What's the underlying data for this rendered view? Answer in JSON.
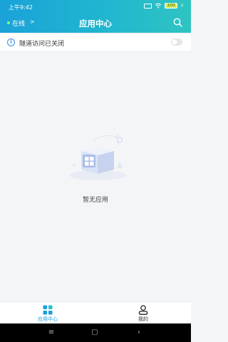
{
  "status_bar": {
    "time": "上午9:42",
    "battery": "100"
  },
  "header": {
    "online_label": "在线",
    "online_chevron": ">",
    "title": "应用中心",
    "brand_colors": [
      "#1aa2d9",
      "#2fc4c2"
    ],
    "search_icon": "search-icon"
  },
  "notice": {
    "icon": "info-icon",
    "icon_glyph": "i",
    "text": "隧道访问已关闭",
    "toggle_on": false
  },
  "empty_state": {
    "illustration": "empty-box-illustration",
    "text": "暂无应用"
  },
  "tabs": [
    {
      "label": "应用中心",
      "icon": "apps-grid-icon",
      "active": true,
      "active_color": "#1a9fe0"
    },
    {
      "label": "我的",
      "icon": "user-icon",
      "active": false
    }
  ],
  "nav": {
    "menu_glyph": "≡",
    "home_glyph": "▢",
    "back_glyph": "‹"
  }
}
